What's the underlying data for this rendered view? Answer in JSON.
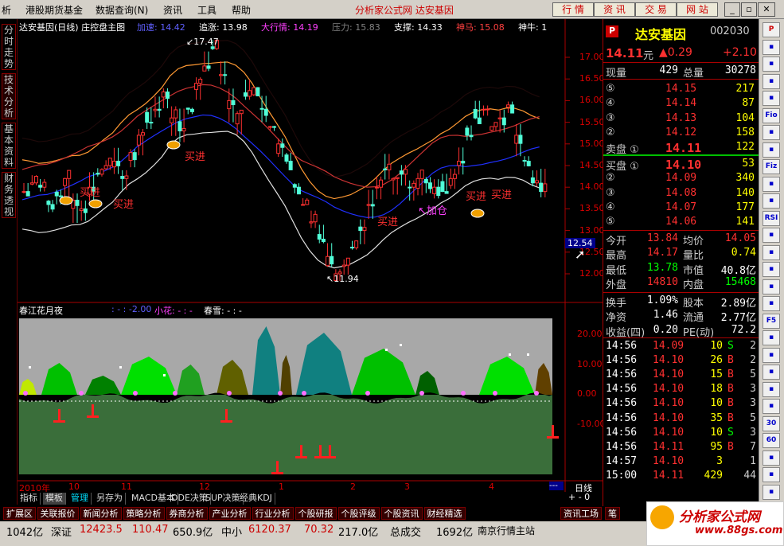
{
  "menubar": {
    "items": [
      "析",
      "港股期货基金",
      "数据查询(N)",
      "资讯",
      "工具",
      "帮助"
    ],
    "site_title": "分析家公式网 达安基因",
    "buttons": [
      "行 情",
      "资 讯",
      "交 易",
      "网 站"
    ]
  },
  "left_tabs": [
    "分时走势",
    "技术分析",
    "基本资料",
    "财务透视"
  ],
  "main_chart": {
    "header": {
      "title": "达安基因(日线) 庄控盘主图",
      "items": [
        {
          "label": "加速:",
          "value": "14.42",
          "color": "#6060ff"
        },
        {
          "label": "追涨:",
          "value": "13.98",
          "color": "#ffffff"
        },
        {
          "label": "大行情:",
          "value": "14.19",
          "color": "#ff40ff"
        },
        {
          "label": "压力:",
          "value": "15.83",
          "color": "#808080"
        },
        {
          "label": "支撑:",
          "value": "14.33",
          "color": "#ffffff"
        },
        {
          "label": "神马:",
          "value": "15.08",
          "color": "#ff4040"
        },
        {
          "label": "神牛:",
          "value": "1",
          "color": "#ffffff"
        }
      ]
    },
    "y_ticks": [
      "17.00",
      "16.50",
      "16.00",
      "15.50",
      "15.00",
      "14.50",
      "14.00",
      "13.50",
      "13.00",
      "12.50",
      "12.00"
    ],
    "annotations": {
      "high": "17.47",
      "low": "11.94",
      "current": "12.54",
      "signals": [
        "买进",
        "买进",
        "买进",
        "买进",
        "加仓",
        "买进",
        "买进"
      ]
    }
  },
  "indicator": {
    "title": "春江花月夜",
    "vals": ": - : -2.00",
    "xiaohua": "小花: - : -",
    "chunxue": "春雪: - : -",
    "y_ticks": [
      "20.00",
      "10.00",
      "0.00",
      "-10.00"
    ]
  },
  "x_axis": {
    "labels": [
      "2010年",
      "10",
      "11",
      "12",
      "1",
      "2",
      "3",
      "4"
    ],
    "period": "日线"
  },
  "tabrow1": [
    "指标",
    "模板",
    "管理",
    "另存为",
    "MACD基本",
    "DDE决策",
    "SUP决策",
    "经典KDJ"
  ],
  "tabrow2": [
    "扩展区",
    "关联报价",
    "新闻分析",
    "策略分析",
    "券商分析",
    "产业分析",
    "行业分析",
    "个股研报",
    "个股评级",
    "个股资讯",
    "财经精选"
  ],
  "tabrow2_right": [
    "资讯工场",
    "笔"
  ],
  "quote": {
    "name": "达安基因",
    "code": "002030",
    "price": "14.11",
    "unit": "元",
    "change": "▲0.29",
    "change_pct": "+2.10",
    "volume_label": "现量",
    "volume": "429",
    "total_label": "总量",
    "total": "30278",
    "sell": [
      {
        "n": "⑤",
        "p": "14.15",
        "v": "217"
      },
      {
        "n": "④",
        "p": "14.14",
        "v": "87"
      },
      {
        "n": "③",
        "p": "14.13",
        "v": "104"
      },
      {
        "n": "②",
        "p": "14.12",
        "v": "158"
      },
      {
        "n": "卖盘 ①",
        "p": "14.11",
        "v": "122"
      }
    ],
    "buy": [
      {
        "n": "买盘 ①",
        "p": "14.10",
        "v": "53"
      },
      {
        "n": "②",
        "p": "14.09",
        "v": "340"
      },
      {
        "n": "③",
        "p": "14.08",
        "v": "140"
      },
      {
        "n": "④",
        "p": "14.07",
        "v": "177"
      },
      {
        "n": "⑤",
        "p": "14.06",
        "v": "141"
      }
    ],
    "stats": [
      {
        "l1": "今开",
        "v1": "13.84",
        "l2": "均价",
        "v2": "14.05"
      },
      {
        "l1": "最高",
        "v1": "14.17",
        "l2": "量比",
        "v2": "0.74"
      },
      {
        "l1": "最低",
        "v1": "13.78",
        "l2": "市值",
        "v2": "40.8亿"
      },
      {
        "l1": "外盘",
        "v1": "14810",
        "l2": "内盘",
        "v2": "15468"
      }
    ],
    "fin": [
      {
        "l1": "换手",
        "v1": "1.09%",
        "l2": "股本",
        "v2": "2.89亿"
      },
      {
        "l1": "净资",
        "v1": "1.46",
        "l2": "流通",
        "v2": "2.77亿"
      },
      {
        "l1": "收益(四)",
        "v1": "0.20",
        "l2": "PE(动)",
        "v2": "72.2"
      }
    ],
    "ticks": [
      {
        "t": "14:56",
        "p": "14.09",
        "v": "10",
        "s": "S",
        "c": "2"
      },
      {
        "t": "14:56",
        "p": "14.10",
        "v": "26",
        "s": "B",
        "c": "2"
      },
      {
        "t": "14:56",
        "p": "14.10",
        "v": "15",
        "s": "B",
        "c": "5"
      },
      {
        "t": "14:56",
        "p": "14.10",
        "v": "18",
        "s": "B",
        "c": "3"
      },
      {
        "t": "14:56",
        "p": "14.10",
        "v": "10",
        "s": "B",
        "c": "3"
      },
      {
        "t": "14:56",
        "p": "14.10",
        "v": "35",
        "s": "B",
        "c": "5"
      },
      {
        "t": "14:56",
        "p": "14.10",
        "v": "10",
        "s": "S",
        "c": "3"
      },
      {
        "t": "14:56",
        "p": "14.11",
        "v": "95",
        "s": "B",
        "c": "7"
      },
      {
        "t": "14:57",
        "p": "14.10",
        "v": "3",
        "s": "",
        "c": "1"
      },
      {
        "t": "15:00",
        "p": "14.11",
        "v": "429",
        "s": "",
        "c": "44"
      }
    ]
  },
  "right_toolbar": [
    "P",
    "",
    "",
    "",
    "",
    "Fio",
    "",
    "",
    "Fiz",
    "",
    "",
    "RSI",
    "",
    "",
    "",
    "",
    "",
    "F5",
    "",
    "",
    "",
    "",
    "",
    "30",
    "60",
    "",
    "",
    ""
  ],
  "status": {
    "a": "1042亿",
    "b_label": "深证",
    "b": "12423.5",
    "c": "110.47",
    "d": "650.9亿",
    "e_label": "中小",
    "e": "6120.37",
    "f": "70.32",
    "g": "217.0亿",
    "h_label": "总成交",
    "h": "1692亿",
    "i": "南京行情主站"
  },
  "logo": {
    "text": "分析家公式网",
    "url": "www.88gs.com"
  },
  "colors": {
    "up": "#ff3030",
    "down": "#00ffff",
    "flat": "#ffffff",
    "green": "#00e000",
    "yellow": "#ffff00",
    "accent": "#cc0000"
  }
}
